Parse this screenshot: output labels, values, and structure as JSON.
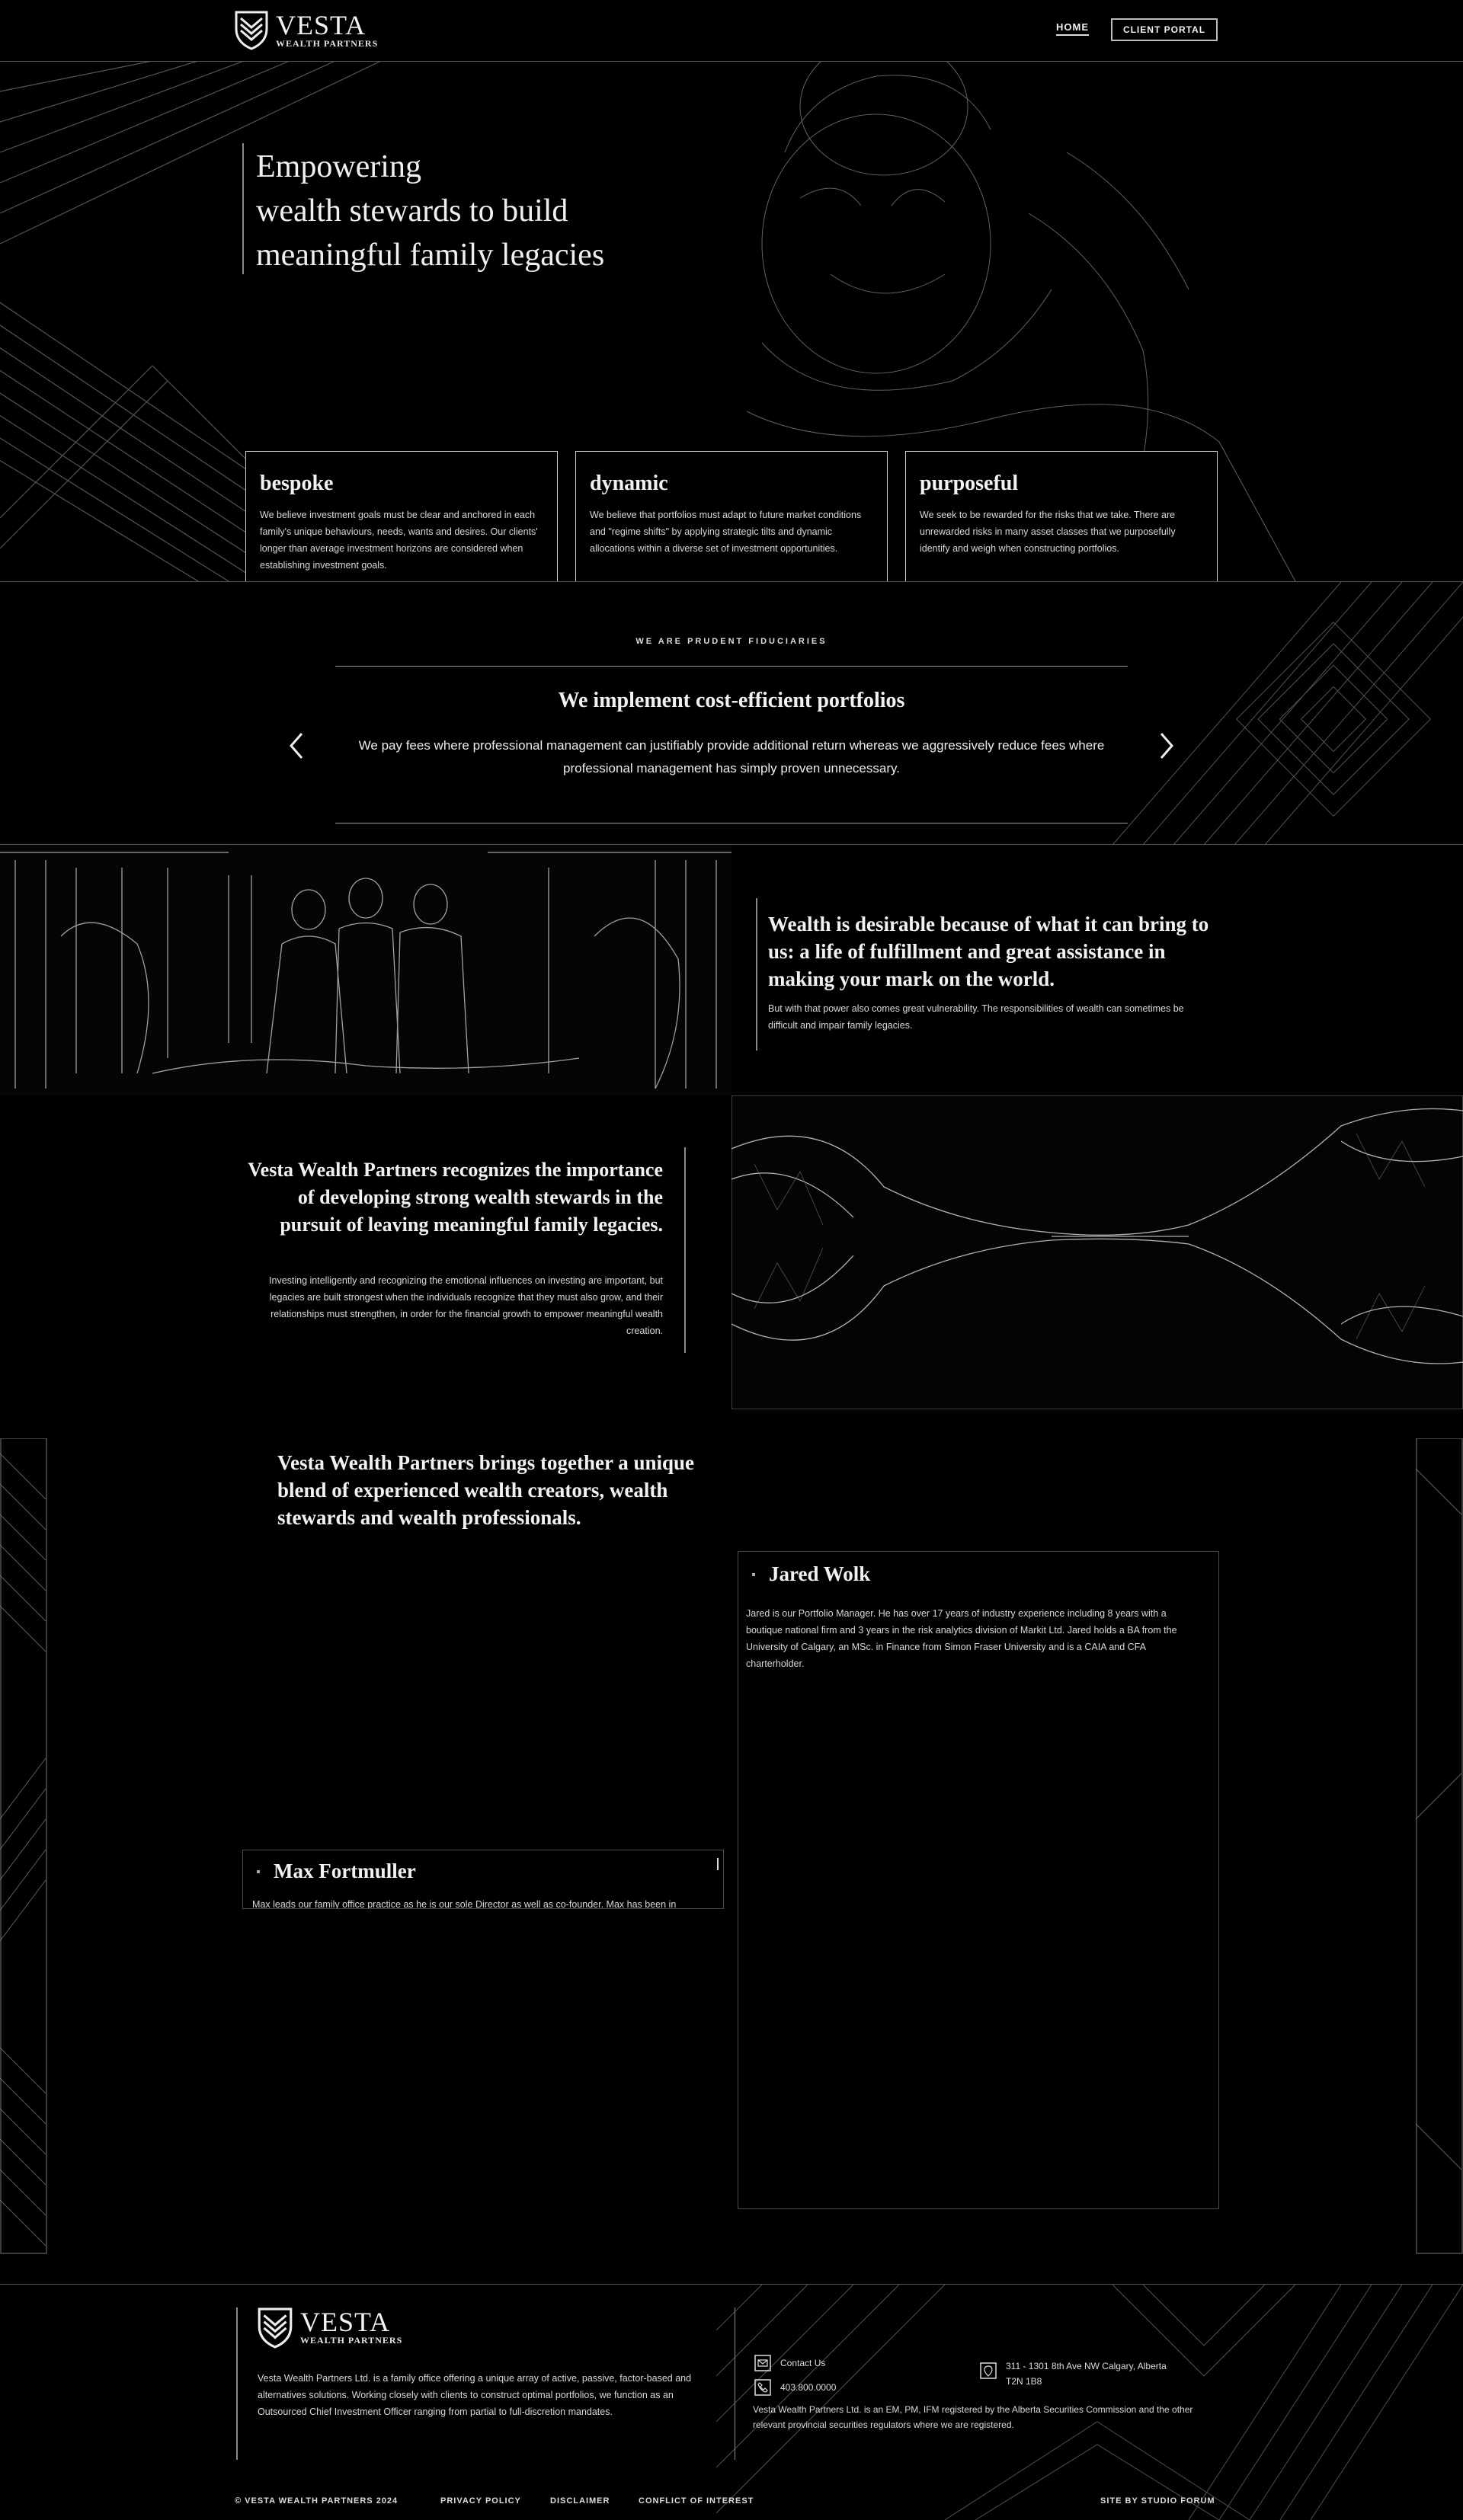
{
  "brand": {
    "name": "VESTA",
    "sub": "WEALTH PARTNERS"
  },
  "nav": {
    "home": "HOME",
    "portal": "CLIENT PORTAL"
  },
  "hero": {
    "title_lines": [
      "Empowering",
      "wealth stewards to build",
      "meaningful family legacies"
    ],
    "cards": [
      {
        "title": "bespoke",
        "text": "We believe investment goals must be clear and anchored in each family's unique behaviours, needs, wants and desires. Our clients' longer than average investment horizons are considered when establishing investment goals."
      },
      {
        "title": "dynamic",
        "text": "We believe that portfolios must adapt to future market conditions and \"regime shifts\" by applying strategic tilts and dynamic allocations within a diverse set of investment opportunities."
      },
      {
        "title": "purposeful",
        "text": "We seek to be rewarded for the risks that we take. There are unrewarded risks in many asset classes that we purposefully identify and weigh when constructing portfolios."
      }
    ]
  },
  "fiduciary": {
    "tag": "WE ARE PRUDENT FIDUCIARIES",
    "heading": "We implement cost-efficient portfolios",
    "text": "We pay fees where professional management can justifiably provide additional return whereas we aggressively reduce fees where professional management has simply proven unnecessary."
  },
  "wealth": {
    "heading": "Wealth is desirable because of what it can bring to us: a life of fulfillment and great assistance in making  your mark on the world.",
    "text": "But with that power also comes great vulnerability. The responsibilities of wealth can sometimes be difficult and impair family legacies."
  },
  "recognize": {
    "heading": "Vesta Wealth Partners recognizes the importance of developing strong wealth stewards in the pursuit of leaving meaningful family legacies.",
    "text": "Investing intelligently and recognizing the emotional influences on investing are important, but legacies are built strongest when the individuals recognize that they must also grow, and their relationships must strengthen, in order for the financial growth to empower meaningful wealth creation."
  },
  "team": {
    "heading": "Vesta Wealth Partners brings together a unique blend of experienced wealth creators, wealth stewards and wealth professionals.",
    "members": [
      {
        "name": "Jared Wolk",
        "bio": "Jared is our Portfolio Manager. He has over 17 years of industry experience including 8 years with a boutique national firm and 3 years in the risk analytics division of Markit Ltd. Jared holds a BA from the University of Calgary, an MSc. in Finance from Simon Fraser University and is a CAIA and CFA charterholder."
      },
      {
        "name": "Max Fortmuller",
        "bio": "Max leads our family office practice as he is our sole Director as well as co-founder. Max has been in"
      }
    ]
  },
  "footer": {
    "text": "Vesta Wealth Partners Ltd. is a family office offering a unique array of active, passive, factor-based and alternatives solutions. Working closely with clients to construct optimal portfolios, we function as an Outsourced Chief Investment Officer ranging from partial to full-discretion mandates.",
    "contact_label": "Contact Us",
    "phone": "403.800.0000",
    "address_line1": "311 - 1301 8th Ave NW Calgary, Alberta",
    "address_line2": "T2N 1B8",
    "disclosure": "Vesta Wealth Partners Ltd. is an EM, PM, IFM registered by the Alberta Securities Commission and the other relevant provincial securities regulators where we are registered.",
    "copyright": "© VESTA WEALTH PARTNERS 2024",
    "links": [
      "PRIVACY POLICY",
      "DISCLAIMER",
      "CONFLICT OF INTEREST"
    ],
    "credit": "SITE BY STUDIO FORUM"
  }
}
